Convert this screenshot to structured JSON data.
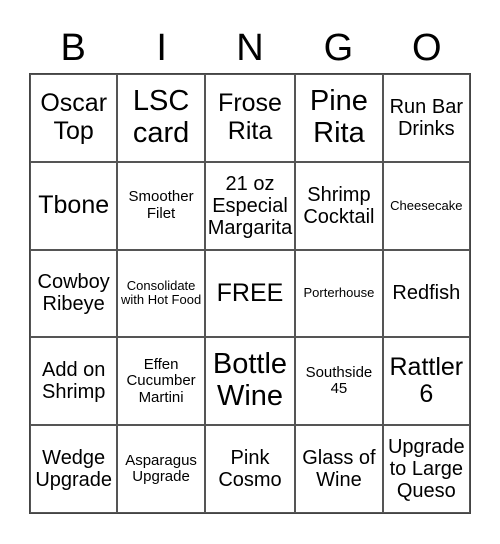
{
  "header": [
    "B",
    "I",
    "N",
    "G",
    "O"
  ],
  "cells": [
    {
      "text": "Oscar Top",
      "size": "l"
    },
    {
      "text": "LSC card",
      "size": "xl"
    },
    {
      "text": "Frose Rita",
      "size": "l"
    },
    {
      "text": "Pine Rita",
      "size": "xl"
    },
    {
      "text": "Run Bar Drinks",
      "size": "m"
    },
    {
      "text": "Tbone",
      "size": "l"
    },
    {
      "text": "Smoother Filet",
      "size": "s"
    },
    {
      "text": "21 oz Especial Margarita",
      "size": "m"
    },
    {
      "text": "Shrimp Cocktail",
      "size": "m"
    },
    {
      "text": "Cheesecake",
      "size": "xs"
    },
    {
      "text": "Cowboy Ribeye",
      "size": "m"
    },
    {
      "text": "Consolidate with Hot Food",
      "size": "xs"
    },
    {
      "text": "FREE",
      "size": "l"
    },
    {
      "text": "Porterhouse",
      "size": "xs"
    },
    {
      "text": "Redfish",
      "size": "m"
    },
    {
      "text": "Add on Shrimp",
      "size": "m"
    },
    {
      "text": "Effen Cucumber Martini",
      "size": "s"
    },
    {
      "text": "Bottle Wine",
      "size": "xl"
    },
    {
      "text": "Southside 45",
      "size": "s"
    },
    {
      "text": "Rattler 6",
      "size": "l"
    },
    {
      "text": "Wedge Upgrade",
      "size": "m"
    },
    {
      "text": "Asparagus Upgrade",
      "size": "s"
    },
    {
      "text": "Pink Cosmo",
      "size": "m"
    },
    {
      "text": "Glass of Wine",
      "size": "m"
    },
    {
      "text": "Upgrade to Large Queso",
      "size": "m"
    }
  ]
}
